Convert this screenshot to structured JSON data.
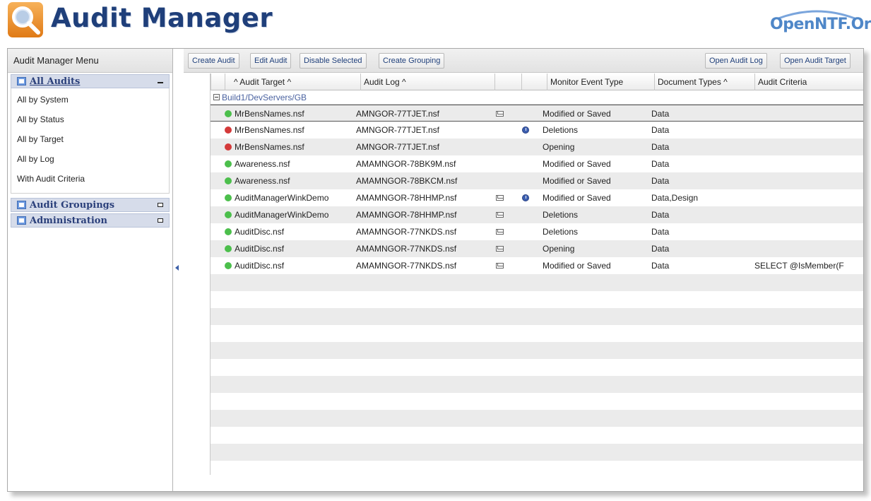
{
  "header": {
    "app_title": "Audit Manager",
    "brand": "OpenNTF.Org"
  },
  "sidebar": {
    "title": "Audit Manager Menu",
    "sections": [
      {
        "label": "All Audits",
        "expanded": true,
        "items": [
          "All by System",
          "All by Status",
          "All by Target",
          "All by Log",
          "With Audit Criteria"
        ]
      },
      {
        "label": "Audit Groupings",
        "expanded": false
      },
      {
        "label": "Administration",
        "expanded": false
      }
    ]
  },
  "toolbar": {
    "create_audit": "Create Audit",
    "edit_audit": "Edit Audit",
    "disable_selected": "Disable Selected",
    "create_grouping": "Create Grouping",
    "open_audit_log": "Open Audit Log",
    "open_audit_target": "Open Audit Target"
  },
  "columns": {
    "audit_target": "^ Audit Target ^",
    "audit_log": "Audit Log ^",
    "monitor_event_type": "Monitor Event Type",
    "document_types": "Document Types ^",
    "audit_criteria": "Audit Criteria"
  },
  "category": "Build1/DevServers/GB",
  "status_colors": {
    "active": "#4cbf4c",
    "disabled": "#d43a3a"
  },
  "rows": [
    {
      "status": "active",
      "target": "MrBensNames.nsf",
      "log": "AMNGOR-77TJET.nsf",
      "mail": true,
      "clock": false,
      "event": "Modified or Saved",
      "doc_types": "Data",
      "criteria": ""
    },
    {
      "status": "disabled",
      "target": "MrBensNames.nsf",
      "log": "AMNGOR-77TJET.nsf",
      "mail": false,
      "clock": true,
      "event": "Deletions",
      "doc_types": "Data",
      "criteria": ""
    },
    {
      "status": "disabled",
      "target": "MrBensNames.nsf",
      "log": "AMNGOR-77TJET.nsf",
      "mail": false,
      "clock": false,
      "event": "Opening",
      "doc_types": "Data",
      "criteria": ""
    },
    {
      "status": "active",
      "target": "Awareness.nsf",
      "log": "AMAMNGOR-78BK9M.nsf",
      "mail": false,
      "clock": false,
      "event": "Modified or Saved",
      "doc_types": "Data",
      "criteria": ""
    },
    {
      "status": "active",
      "target": "Awareness.nsf",
      "log": "AMAMNGOR-78BKCM.nsf",
      "mail": false,
      "clock": false,
      "event": "Modified or Saved",
      "doc_types": "Data",
      "criteria": ""
    },
    {
      "status": "active",
      "target": "AuditManagerWinkDemo",
      "log": "AMAMNGOR-78HHMP.nsf",
      "mail": true,
      "clock": true,
      "event": "Modified or Saved",
      "doc_types": "Data,Design",
      "criteria": ""
    },
    {
      "status": "active",
      "target": "AuditManagerWinkDemo",
      "log": "AMAMNGOR-78HHMP.nsf",
      "mail": true,
      "clock": false,
      "event": "Deletions",
      "doc_types": "Data",
      "criteria": ""
    },
    {
      "status": "active",
      "target": "AuditDisc.nsf",
      "log": "AMAMNGOR-77NKDS.nsf",
      "mail": true,
      "clock": false,
      "event": "Deletions",
      "doc_types": "Data",
      "criteria": ""
    },
    {
      "status": "active",
      "target": "AuditDisc.nsf",
      "log": "AMAMNGOR-77NKDS.nsf",
      "mail": true,
      "clock": false,
      "event": "Opening",
      "doc_types": "Data",
      "criteria": ""
    },
    {
      "status": "active",
      "target": "AuditDisc.nsf",
      "log": "AMAMNGOR-77NKDS.nsf",
      "mail": true,
      "clock": false,
      "event": "Modified or Saved",
      "doc_types": "Data",
      "criteria": "SELECT @IsMember(F"
    }
  ]
}
